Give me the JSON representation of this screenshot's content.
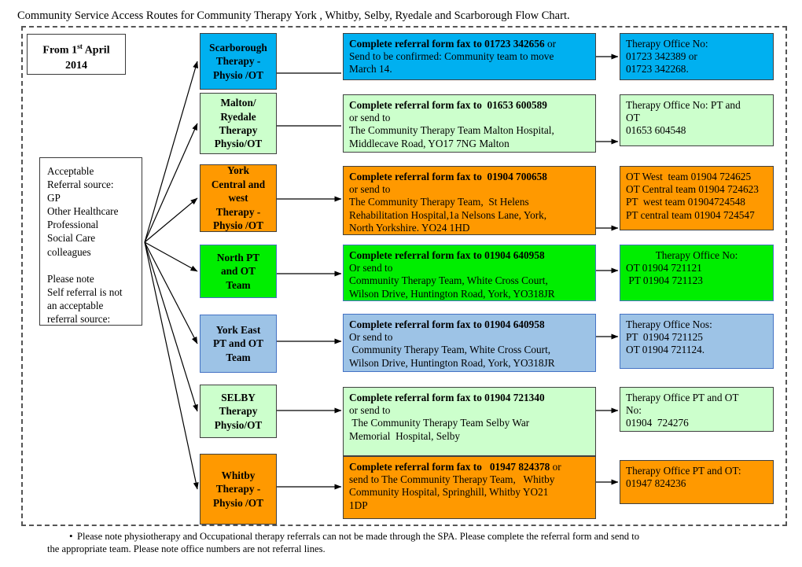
{
  "title": "Community Service Access Routes for Community Therapy York , Whitby, Selby, Ryedale and Scarborough Flow Chart.",
  "date_box": {
    "prefix": "From 1",
    "sup": "st",
    "suffix": " April",
    "line2": "2014"
  },
  "source_box": {
    "lines": [
      "Acceptable",
      "Referral source:",
      "GP",
      "Other Healthcare",
      "Professional",
      "Social Care",
      "colleagues",
      "",
      "Please note",
      "Self referral is not",
      "an acceptable",
      "referral source:"
    ]
  },
  "colors": {
    "cyan": "#00b0f0",
    "light_green": "#ccffcc",
    "orange": "#ff9900",
    "bright_green": "#00ee00",
    "steel_blue": "#9dc3e6",
    "border_dark": "#404040",
    "border_blue": "#4472c4",
    "border_lavender": "#ccccff"
  },
  "rows": [
    {
      "key": "scarborough",
      "color": "#00b0f0",
      "team_lines": [
        "Scarborough",
        "Therapy -",
        "Physio /OT"
      ],
      "referral_lines": [
        {
          "text": "Complete referral form fax to 01723 342656 ",
          "bold": true,
          "inline": true
        },
        {
          "text": "or",
          "bold": false,
          "inline": true
        },
        {
          "text": "Send to be confirmed: Community team to move",
          "bold": false
        },
        {
          "text": "March 14.",
          "bold": false
        }
      ],
      "office_lines": [
        "Therapy Office No:",
        "01723 342389 or",
        "01723 342268."
      ]
    },
    {
      "key": "malton-ryedale",
      "color": "#ccffcc",
      "team_lines": [
        "Malton/",
        "Ryedale",
        "Therapy",
        "Physio/OT"
      ],
      "referral_lines": [
        {
          "text": "Complete referral form fax to  01653 600589",
          "bold": true
        },
        {
          "text": "or send to",
          "bold": false
        },
        {
          "text": "The Community Therapy Team Malton Hospital,",
          "bold": false
        },
        {
          "text": "Middlecave Road, YO17 7NG Malton",
          "bold": false
        }
      ],
      "office_lines": [
        "Therapy Office No: PT and",
        "OT",
        "01653 604548"
      ]
    },
    {
      "key": "york-central-west",
      "color": "#ff9900",
      "team_lines": [
        "York",
        "Central and",
        "west",
        "Therapy -",
        "Physio /OT"
      ],
      "referral_lines": [
        {
          "text": "Complete referral form fax to  01904 700658",
          "bold": true
        },
        {
          "text": "or send to",
          "bold": false
        },
        {
          "text": "The Community Therapy Team,  St Helens",
          "bold": false
        },
        {
          "text": "Rehabilitation Hospital,1a Nelsons Lane, York,",
          "bold": false
        },
        {
          "text": "North Yorkshire. YO24 1HD",
          "bold": false
        }
      ],
      "office_lines": [
        "OT West  team 01904 724625",
        "OT Central team 01904 724623",
        "PT  west team 01904724548",
        "PT central team 01904 724547"
      ]
    },
    {
      "key": "north-pt-ot",
      "color": "#00ee00",
      "team_lines": [
        "North PT",
        "and OT",
        "Team"
      ],
      "referral_lines": [
        {
          "text": "Complete referral form fax to 01904 640958",
          "bold": true
        },
        {
          "text": "Or send to",
          "bold": false
        },
        {
          "text": "Community Therapy Team, White Cross Court,",
          "bold": false
        },
        {
          "text": "Wilson Drive, Huntington Road, York, YO318JR",
          "bold": false
        }
      ],
      "office_lines": [
        "Therapy Office No:",
        "OT 01904 721121",
        " PT 01904 721123"
      ],
      "office_first_centered": true
    },
    {
      "key": "york-east-pt-ot",
      "color": "#9dc3e6",
      "team_lines": [
        "York East",
        "PT and OT",
        "Team"
      ],
      "referral_lines": [
        {
          "text": "Complete referral form fax to 01904 640958",
          "bold": true
        },
        {
          "text": "Or send to",
          "bold": false
        },
        {
          "text": " Community Therapy Team, White Cross Court,",
          "bold": false
        },
        {
          "text": "Wilson Drive, Huntington Road, York, YO318JR",
          "bold": false
        }
      ],
      "office_lines": [
        "Therapy Office Nos:",
        "PT  01904 721125",
        "OT 01904 721124."
      ]
    },
    {
      "key": "selby",
      "color": "#ccffcc",
      "team_lines": [
        "SELBY",
        "Therapy",
        "Physio/OT"
      ],
      "referral_lines": [
        {
          "text": "Complete referral form fax to 01904 721340",
          "bold": true
        },
        {
          "text": "or send to",
          "bold": false
        },
        {
          "text": " The Community Therapy Team Selby War",
          "bold": false
        },
        {
          "text": "Memorial  Hospital, Selby",
          "bold": false
        }
      ],
      "office_lines": [
        "Therapy Office PT and OT",
        "No:",
        "01904  724276"
      ]
    },
    {
      "key": "whitby",
      "color": "#ff9900",
      "team_lines": [
        "Whitby",
        "Therapy -",
        "Physio /OT"
      ],
      "referral_lines": [
        {
          "text": "Complete referral form fax to   01947 824378 ",
          "bold": true,
          "inline": true
        },
        {
          "text": "or",
          "bold": false,
          "inline": true
        },
        {
          "text": "send to The Community Therapy Team,   Whitby",
          "bold": false
        },
        {
          "text": "Community Hospital, Springhill, Whitby YO21",
          "bold": false
        },
        {
          "text": "1DP",
          "bold": false
        }
      ],
      "office_lines": [
        "Therapy Office PT and OT:",
        "01947 824236"
      ]
    }
  ],
  "footer": {
    "bullet": "•",
    "line1": "Please note physiotherapy and Occupational therapy referrals can not be made through the SPA. Please complete the referral form and send to",
    "line2": "the appropriate team. Please note office numbers are not referral lines."
  }
}
